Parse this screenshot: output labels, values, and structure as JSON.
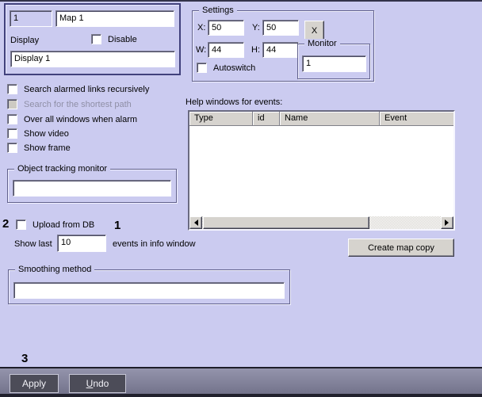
{
  "map_panel": {
    "id_value": "1",
    "name_value": "Map 1",
    "display_label": "Display",
    "disable_label": "Disable",
    "display_value": "Display 1"
  },
  "options": {
    "items": [
      {
        "label": "Search alarmed links recursively"
      },
      {
        "label": "Search for the shortest path"
      },
      {
        "label": "Over all windows when alarm"
      },
      {
        "label": "Show video"
      },
      {
        "label": "Show frame"
      }
    ]
  },
  "tracking": {
    "caption": "Object tracking monitor",
    "value": ""
  },
  "upload": {
    "annotation_2": "2",
    "label": "Upload from DB",
    "annotation_1": "1"
  },
  "show_last": {
    "label": "Show last",
    "value": "10",
    "suffix": "events in info window"
  },
  "smoothing": {
    "caption": "Smoothing method",
    "value": ""
  },
  "settings": {
    "caption": "Settings",
    "x_label": "X:",
    "x_value": "50",
    "y_label": "Y:",
    "y_value": "50",
    "w_label": "W:",
    "w_value": "44",
    "h_label": "H:",
    "h_value": "44",
    "close_label": "X",
    "monitor_caption": "Monitor",
    "monitor_value": "1",
    "autoswitch_label": "Autoswitch"
  },
  "help_table": {
    "label": "Help windows for events:",
    "columns": [
      "Type",
      "id",
      "Name",
      "Event"
    ],
    "rows": []
  },
  "create_map_copy_label": "Create map copy",
  "bottom_bar": {
    "annotation_3": "3",
    "apply_label": "Apply",
    "undo_initial": "U",
    "undo_rest": "ndo"
  },
  "colors": {
    "dialog_bg": "#cbcbf0",
    "group_border": "#60608c",
    "button_face": "#d6d3ce",
    "bar_button_bg": "#4c4c58",
    "bar_gradient_top": "#9494ac",
    "bar_gradient_bottom": "#73738b"
  }
}
